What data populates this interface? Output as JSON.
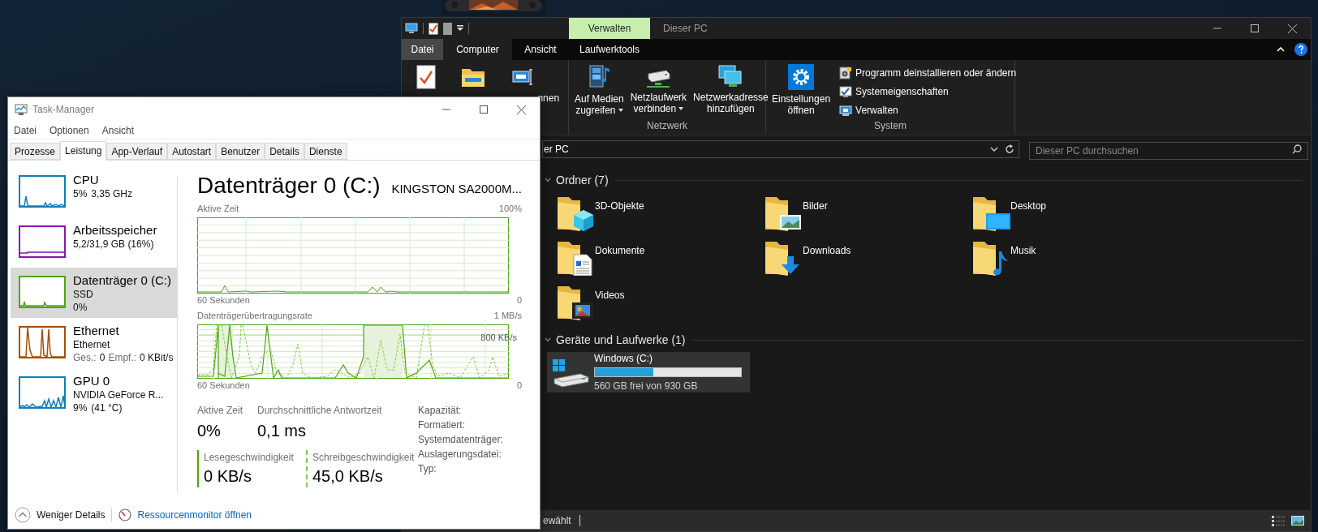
{
  "explorer": {
    "context_tab": "Verwalten",
    "title": "Dieser PC",
    "ribbon_tabs": [
      {
        "label": "Datei",
        "kind": "file",
        "selected": false
      },
      {
        "label": "Computer",
        "kind": "tab",
        "selected": true
      },
      {
        "label": "Ansicht",
        "kind": "tab",
        "selected": false
      },
      {
        "label": "Laufwerktools",
        "kind": "tab",
        "selected": false
      }
    ],
    "cut_group": {
      "partial_label": "nnen"
    },
    "ribbon_groups": [
      {
        "label": "Netzwerk",
        "items": [
          {
            "kind": "large",
            "lines": [
              "Auf Medien",
              "zugreifen"
            ],
            "dropdown": true
          },
          {
            "kind": "large",
            "lines": [
              "Netzlaufwerk",
              "verbinden"
            ],
            "dropdown": true
          },
          {
            "kind": "large",
            "lines": [
              "Netzwerkadresse",
              "hinzufügen"
            ],
            "dropdown": false
          }
        ]
      },
      {
        "label": "System",
        "items": [
          {
            "kind": "large",
            "lines": [
              "Einstellungen",
              "öffnen"
            ],
            "dropdown": false
          },
          {
            "kind": "small",
            "label": "Programm deinstallieren oder ändern"
          },
          {
            "kind": "small",
            "label": "Systemeigenschaften"
          },
          {
            "kind": "small",
            "label": "Verwalten"
          }
        ]
      }
    ],
    "address": {
      "value": "er PC"
    },
    "search": {
      "placeholder": "Dieser PC durchsuchen"
    },
    "sections": [
      {
        "title": "Ordner (7)",
        "kind": "folders",
        "items": [
          {
            "label": "3D-Objekte",
            "kind": "objects"
          },
          {
            "label": "Bilder",
            "kind": "pictures"
          },
          {
            "label": "Desktop",
            "kind": "desktop"
          },
          {
            "label": "Dokumente",
            "kind": "documents"
          },
          {
            "label": "Downloads",
            "kind": "downloads"
          },
          {
            "label": "Musik",
            "kind": "music"
          },
          {
            "label": "Videos",
            "kind": "videos"
          }
        ]
      },
      {
        "title": "Geräte und Laufwerke (1)",
        "kind": "drives",
        "items": [
          {
            "label": "Windows (C:)",
            "level": 0.4,
            "detail": "560 GB frei von 930 GB"
          }
        ]
      }
    ],
    "status_bar": {
      "text": "ewählt"
    }
  },
  "task_manager": {
    "title": "Task-Manager",
    "menu": [
      "Datei",
      "Optionen",
      "Ansicht"
    ],
    "tabs": [
      {
        "label": "Prozesse",
        "selected": false
      },
      {
        "label": "Leistung",
        "selected": true
      },
      {
        "label": "App-Verlauf",
        "selected": false
      },
      {
        "label": "Autostart",
        "selected": false
      },
      {
        "label": "Benutzer",
        "selected": false
      },
      {
        "label": "Details",
        "selected": false
      },
      {
        "label": "Dienste",
        "selected": false
      }
    ],
    "devices": [
      {
        "kind": "cpu",
        "name": "CPU",
        "color": "#117dbb",
        "selected": false,
        "values": [
          "5%",
          "3,35 GHz"
        ]
      },
      {
        "kind": "memory",
        "name": "Arbeitsspeicher",
        "color": "#8b12ae",
        "selected": false,
        "values": [
          "5,2/31,9 GB (16%)"
        ]
      },
      {
        "kind": "disk",
        "name": "Datenträger 0 (C:)",
        "color": "#4da60c",
        "selected": true,
        "subtitle": "SSD",
        "values": [
          "0%"
        ]
      },
      {
        "kind": "ethernet",
        "name": "Ethernet",
        "color": "#a74f01",
        "selected": false,
        "subtitle": "Ethernet",
        "rates": [
          {
            "label": "Ges.:",
            "value": "0"
          },
          {
            "label": "Empf.:",
            "value": "0 KBit/s"
          }
        ]
      },
      {
        "kind": "gpu",
        "name": "GPU 0",
        "color": "#117dbb",
        "selected": false,
        "subtitle": "NVIDIA GeForce R...",
        "values": [
          "9%",
          "(41 °C)"
        ]
      }
    ],
    "detail": {
      "heading": "Datenträger 0 (C:)",
      "model": "KINGSTON SA2000M...",
      "graphs": [
        {
          "kind": "active",
          "title": "Aktive Zeit",
          "max": "100%",
          "xlabel": "60 Sekunden",
          "min": "0"
        },
        {
          "kind": "transfer",
          "title": "Datenträgerübertragungsrate",
          "max": "1 MB/s",
          "mid_label": "800 KB/s",
          "xlabel": "60 Sekunden",
          "min": "0"
        }
      ],
      "stats": [
        {
          "label": "Aktive Zeit",
          "value": "0%"
        },
        {
          "label": "Durchschnittliche Antwortzeit",
          "value": "0,1 ms"
        }
      ],
      "rates": [
        {
          "label": "Lesegeschwindigkeit",
          "value": "0 KB/s",
          "kind": "solid"
        },
        {
          "label": "Schreibgeschwindigkeit",
          "value": "45,0 KB/s",
          "kind": "dashed"
        }
      ],
      "properties": [
        "Kapazität:",
        "Formatiert:",
        "Systemdatenträger:",
        "Auslagerungsdatei:",
        "Typ:"
      ]
    },
    "footer": {
      "less": "Weniger Details",
      "link": "Ressourcenmonitor öffnen"
    }
  }
}
